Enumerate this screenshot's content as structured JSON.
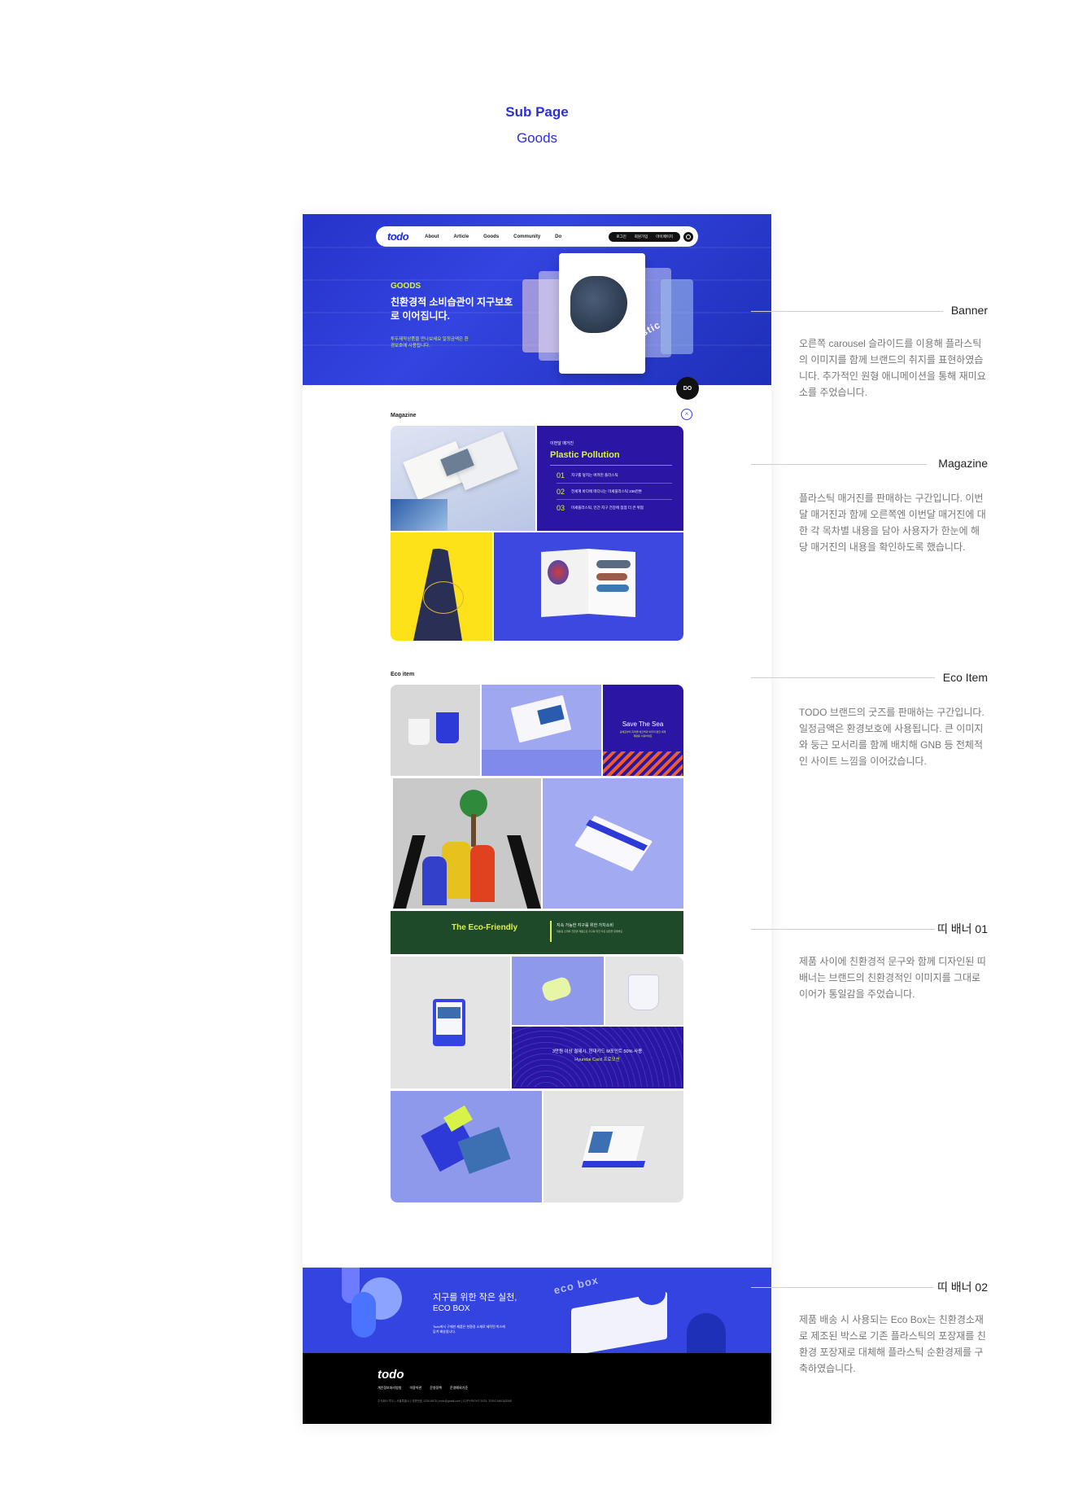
{
  "heading": {
    "title": "Sub Page",
    "subtitle": "Goods"
  },
  "gnb": {
    "logo": "todo",
    "menu": [
      "About",
      "Article",
      "Goods",
      "Community",
      "Do"
    ],
    "util": [
      "로그인",
      "회원가입",
      "마이페이지"
    ]
  },
  "banner": {
    "eyebrow": "GOODS",
    "title": "친환경적 소비습관이 지구보호로 이어집니다.",
    "desc": "투두제작상품을 만나보세요 일정금액은 환경보호에 사용됩니다.",
    "arc_text": "plastic plastic",
    "do_badge": "DO"
  },
  "magazine": {
    "label": "Magazine",
    "up_icon": "chevron-up-icon",
    "kicker": "이번달 매거진",
    "title": "Plastic Pollution",
    "items": [
      {
        "num": "01",
        "text": "지구를 덮치는 버려진 플라스틱"
      },
      {
        "num": "02",
        "text": "전세계 바다에 떠다니는 미세플라스틱 236만톤"
      },
      {
        "num": "03",
        "text": "미세플라스틱, 인간·지구 건강에 점점 더 큰 위협"
      }
    ]
  },
  "eco": {
    "label": "Eco item",
    "save_sea": "Save The Sea",
    "save_sea_sub": "공해로부터 지켜줄 에코백과 아무리 편한 세계 재활용 사용하세요",
    "strip_title": "The Eco-Friendly",
    "strip_text": "지속 가능한 지구를 위한 가치소비",
    "strip_sub": "재활용 소재와 친환경 제품으로 지구를 위한 작은 실천을 함께해요",
    "card_promo": "3만원 이상 결제시, 현대카드 M포인트 50% 사용",
    "card_promo_sub": "Hyundai Card 프로모션"
  },
  "ecobox": {
    "title1": "지구를 위한 작은 실천,",
    "title2": "ECO BOX",
    "desc": "Todo에서 구매한 제품은 친환경 소재로 제작된 박스에 담겨 배송됩니다.",
    "label": "eco box"
  },
  "footer": {
    "logo": "todo",
    "links": [
      "개인정보처리방침",
      "이용약관",
      "운영정책",
      "운영예외기준"
    ],
    "info": "주식회사 투두 | 서울특별시 | 대표번호 1234-5678 | todo@gmail.com | COPYRIGHT 2023. TODO MAGAZINE"
  },
  "annotations": [
    {
      "title": "Banner",
      "desc": "오른쪽 carousel 슬라이드를 이용해 플라스틱의 이미지를 함께 브랜드의 취지를 표현하였습니다. 추가적인 원형 애니메이션을 통해 재미요소를 주었습니다."
    },
    {
      "title": "Magazine",
      "desc": "플라스틱 매거진를 판매하는 구간입니다. 이번달 매거진과 함께 오른쪽엔 이번달 매거진에 대한 각 목차별 내용을 담아 사용자가 한눈에 해당 매거진의 내용을 확인하도록 했습니다."
    },
    {
      "title": "Eco Item",
      "desc": "TODO 브랜드의 굿즈를 판매하는 구간입니다. 일정금액은 환경보호에 사용됩니다. 큰 이미지와 둥근 모서리를 함께 배치해 GNB 등 전체적인 사이트 느낌을 이어갔습니다."
    },
    {
      "title": "띠 배너 01",
      "desc": "제품 사이에 친환경적 문구와 함께 디자인된 띠배너는 브랜드의 친환경적인 이미지를 그대로 이어가 통일감을 주었습니다."
    },
    {
      "title": "띠 배너 02",
      "desc": "제품 배송 시 사용되는 Eco Box는 친환경소재로 제조된 박스로 기존 플라스틱의 포장재를 친환경 포장재로 대체해 플라스틱 순환경제를 구축하였습니다."
    }
  ],
  "colors": {
    "brand_blue": "#3344e0",
    "accent_lime": "#d9f24a",
    "navy": "#2a16a3"
  }
}
